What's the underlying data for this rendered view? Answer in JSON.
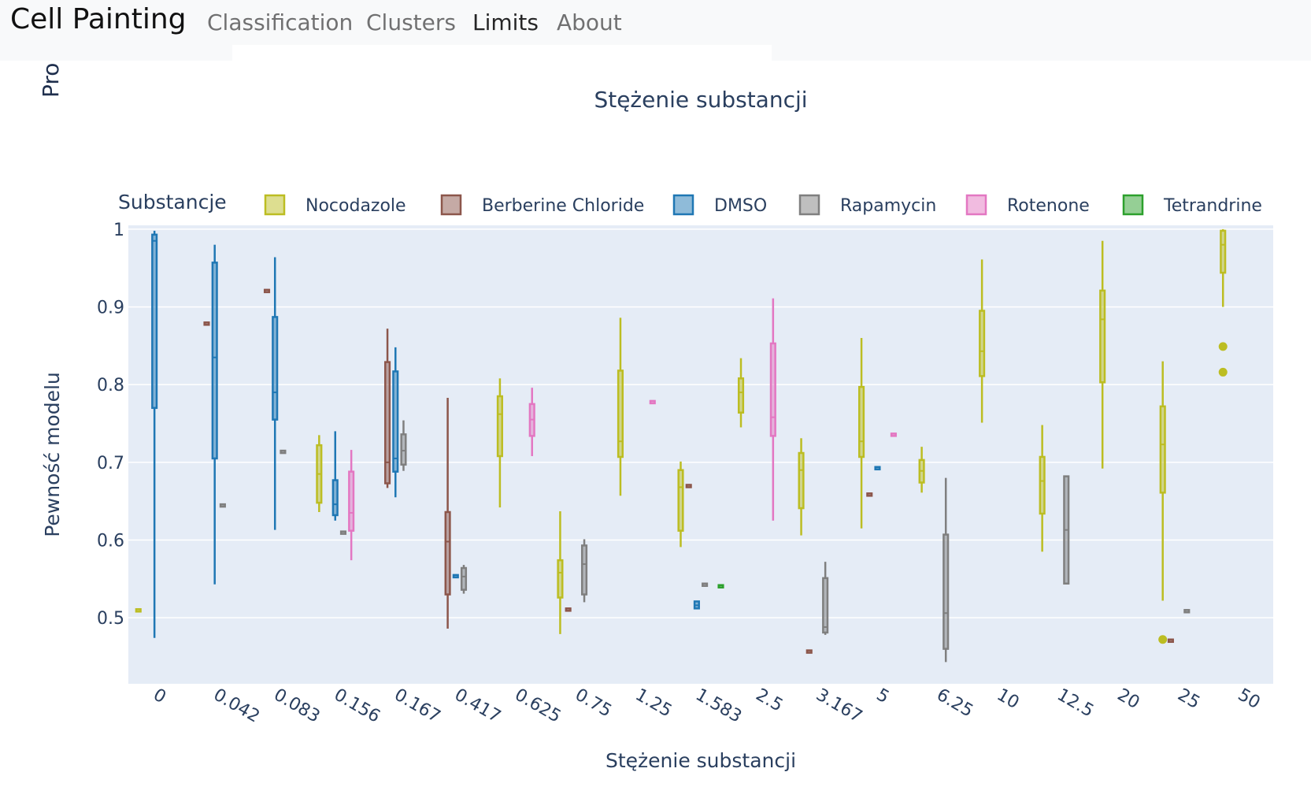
{
  "navbar": {
    "brand": "Cell Painting",
    "links": [
      {
        "label": "Classification",
        "active": false
      },
      {
        "label": "Clusters",
        "active": false
      },
      {
        "label": "Limits",
        "active": true
      },
      {
        "label": "About",
        "active": false
      }
    ]
  },
  "page": {
    "clipped_heading": "Pro"
  },
  "chart_data": {
    "type": "box",
    "title": "Stężenie substancji",
    "xlabel": "Stężenie substancji",
    "ylabel": "Pewność modelu",
    "legend_title": "Substancje",
    "legend_position": "top",
    "grid": true,
    "ylim": [
      0.415,
      1.005
    ],
    "yticks": [
      0.5,
      0.6,
      0.7,
      0.8,
      0.9,
      1
    ],
    "ytick_labels": [
      "0.5",
      "0.6",
      "0.7",
      "0.8",
      "0.9",
      "1"
    ],
    "categories": [
      "0",
      "0.042",
      "0.083",
      "0.156",
      "0.167",
      "0.417",
      "0.625",
      "0.75",
      "1.25",
      "1.583",
      "2.5",
      "3.167",
      "5",
      "6.25",
      "10",
      "12.5",
      "20",
      "25",
      "50"
    ],
    "series": [
      {
        "name": "Nocodazole",
        "color": "#bcbd22",
        "boxes": [
          {
            "category": "0",
            "min": 0.511,
            "q1": 0.511,
            "median": 0.511,
            "q3": 0.511,
            "max": 0.511
          },
          {
            "category": "0.156",
            "min": 0.636,
            "q1": 0.648,
            "median": 0.685,
            "q3": 0.722,
            "max": 0.735
          },
          {
            "category": "0.625",
            "min": 0.642,
            "q1": 0.708,
            "median": 0.762,
            "q3": 0.785,
            "max": 0.808
          },
          {
            "category": "0.75",
            "min": 0.479,
            "q1": 0.526,
            "median": 0.558,
            "q3": 0.574,
            "max": 0.637
          },
          {
            "category": "1.25",
            "min": 0.657,
            "q1": 0.707,
            "median": 0.727,
            "q3": 0.818,
            "max": 0.886
          },
          {
            "category": "1.583",
            "min": 0.591,
            "q1": 0.612,
            "median": 0.668,
            "q3": 0.69,
            "max": 0.701
          },
          {
            "category": "2.5",
            "min": 0.745,
            "q1": 0.764,
            "median": 0.79,
            "q3": 0.808,
            "max": 0.834
          },
          {
            "category": "3.167",
            "min": 0.606,
            "q1": 0.641,
            "median": 0.69,
            "q3": 0.712,
            "max": 0.731
          },
          {
            "category": "5",
            "min": 0.615,
            "q1": 0.707,
            "median": 0.727,
            "q3": 0.797,
            "max": 0.86
          },
          {
            "category": "6.25",
            "min": 0.661,
            "q1": 0.674,
            "median": 0.689,
            "q3": 0.703,
            "max": 0.72
          },
          {
            "category": "10",
            "min": 0.751,
            "q1": 0.811,
            "median": 0.843,
            "q3": 0.895,
            "max": 0.961
          },
          {
            "category": "12.5",
            "min": 0.585,
            "q1": 0.634,
            "median": 0.676,
            "q3": 0.707,
            "max": 0.748
          },
          {
            "category": "20",
            "min": 0.692,
            "q1": 0.803,
            "median": 0.884,
            "q3": 0.921,
            "max": 0.985
          },
          {
            "category": "25",
            "min": 0.522,
            "q1": 0.661,
            "median": 0.723,
            "q3": 0.772,
            "max": 0.83,
            "outliers": [
              0.472
            ]
          },
          {
            "category": "50",
            "min": 0.9,
            "q1": 0.944,
            "median": 0.98,
            "q3": 0.998,
            "max": 1.0,
            "outliers": [
              0.849,
              0.816
            ]
          }
        ]
      },
      {
        "name": "Berberine Chloride",
        "color": "#8c564b",
        "boxes": [
          {
            "category": "0.042",
            "min": 0.88,
            "q1": 0.88,
            "median": 0.88,
            "q3": 0.88,
            "max": 0.88
          },
          {
            "category": "0.083",
            "min": 0.922,
            "q1": 0.922,
            "median": 0.922,
            "q3": 0.922,
            "max": 0.922
          },
          {
            "category": "0.167",
            "min": 0.667,
            "q1": 0.673,
            "median": 0.7,
            "q3": 0.829,
            "max": 0.872
          },
          {
            "category": "0.417",
            "min": 0.486,
            "q1": 0.53,
            "median": 0.598,
            "q3": 0.636,
            "max": 0.783
          },
          {
            "category": "0.75",
            "min": 0.512,
            "q1": 0.512,
            "median": 0.512,
            "q3": 0.512,
            "max": 0.512
          },
          {
            "category": "1.583",
            "min": 0.671,
            "q1": 0.671,
            "median": 0.671,
            "q3": 0.671,
            "max": 0.671
          },
          {
            "category": "3.167",
            "min": 0.458,
            "q1": 0.458,
            "median": 0.458,
            "q3": 0.458,
            "max": 0.458
          },
          {
            "category": "5",
            "min": 0.66,
            "q1": 0.66,
            "median": 0.66,
            "q3": 0.66,
            "max": 0.66
          },
          {
            "category": "25",
            "min": 0.472,
            "q1": 0.472,
            "median": 0.472,
            "q3": 0.472,
            "max": 0.472
          }
        ]
      },
      {
        "name": "DMSO",
        "color": "#1f77b4",
        "boxes": [
          {
            "category": "0",
            "min": 0.474,
            "q1": 0.77,
            "median": 0.985,
            "q3": 0.993,
            "max": 0.998
          },
          {
            "category": "0.042",
            "min": 0.543,
            "q1": 0.705,
            "median": 0.835,
            "q3": 0.957,
            "max": 0.98
          },
          {
            "category": "0.083",
            "min": 0.613,
            "q1": 0.755,
            "median": 0.79,
            "q3": 0.887,
            "max": 0.964
          },
          {
            "category": "0.156",
            "min": 0.625,
            "q1": 0.632,
            "median": 0.646,
            "q3": 0.677,
            "max": 0.74
          },
          {
            "category": "0.167",
            "min": 0.655,
            "q1": 0.688,
            "median": 0.705,
            "q3": 0.817,
            "max": 0.848
          },
          {
            "category": "0.417",
            "min": 0.555,
            "q1": 0.555,
            "median": 0.555,
            "q3": 0.555,
            "max": 0.555
          },
          {
            "category": "1.583",
            "min": 0.512,
            "q1": 0.512,
            "median": 0.516,
            "q3": 0.521,
            "max": 0.521
          },
          {
            "category": "5",
            "min": 0.694,
            "q1": 0.694,
            "median": 0.694,
            "q3": 0.694,
            "max": 0.694
          }
        ]
      },
      {
        "name": "Rapamycin",
        "color": "#7f7f7f",
        "boxes": [
          {
            "category": "0.042",
            "min": 0.646,
            "q1": 0.646,
            "median": 0.646,
            "q3": 0.646,
            "max": 0.646
          },
          {
            "category": "0.083",
            "min": 0.715,
            "q1": 0.715,
            "median": 0.715,
            "q3": 0.715,
            "max": 0.715
          },
          {
            "category": "0.156",
            "min": 0.611,
            "q1": 0.611,
            "median": 0.611,
            "q3": 0.611,
            "max": 0.611
          },
          {
            "category": "0.167",
            "min": 0.689,
            "q1": 0.697,
            "median": 0.715,
            "q3": 0.736,
            "max": 0.754
          },
          {
            "category": "0.417",
            "min": 0.531,
            "q1": 0.536,
            "median": 0.553,
            "q3": 0.564,
            "max": 0.568
          },
          {
            "category": "0.75",
            "min": 0.52,
            "q1": 0.53,
            "median": 0.569,
            "q3": 0.593,
            "max": 0.601
          },
          {
            "category": "1.583",
            "min": 0.544,
            "q1": 0.544,
            "median": 0.544,
            "q3": 0.544,
            "max": 0.544
          },
          {
            "category": "3.167",
            "min": 0.478,
            "q1": 0.481,
            "median": 0.488,
            "q3": 0.551,
            "max": 0.572
          },
          {
            "category": "6.25",
            "min": 0.443,
            "q1": 0.46,
            "median": 0.506,
            "q3": 0.607,
            "max": 0.68
          },
          {
            "category": "12.5",
            "min": 0.544,
            "q1": 0.544,
            "median": 0.613,
            "q3": 0.682,
            "max": 0.682
          },
          {
            "category": "25",
            "min": 0.51,
            "q1": 0.51,
            "median": 0.51,
            "q3": 0.51,
            "max": 0.51
          }
        ]
      },
      {
        "name": "Rotenone",
        "color": "#e377c2",
        "boxes": [
          {
            "category": "0.156",
            "min": 0.574,
            "q1": 0.612,
            "median": 0.635,
            "q3": 0.688,
            "max": 0.716
          },
          {
            "category": "0.625",
            "min": 0.708,
            "q1": 0.734,
            "median": 0.755,
            "q3": 0.775,
            "max": 0.796
          },
          {
            "category": "1.25",
            "min": 0.779,
            "q1": 0.779,
            "median": 0.779,
            "q3": 0.779,
            "max": 0.779
          },
          {
            "category": "2.5",
            "min": 0.625,
            "q1": 0.734,
            "median": 0.758,
            "q3": 0.853,
            "max": 0.911
          },
          {
            "category": "5",
            "min": 0.737,
            "q1": 0.737,
            "median": 0.737,
            "q3": 0.737,
            "max": 0.737
          }
        ]
      },
      {
        "name": "Tetrandrine",
        "color": "#2ca02c",
        "boxes": [
          {
            "category": "1.583",
            "min": 0.542,
            "q1": 0.542,
            "median": 0.542,
            "q3": 0.542,
            "max": 0.542
          }
        ]
      }
    ]
  }
}
